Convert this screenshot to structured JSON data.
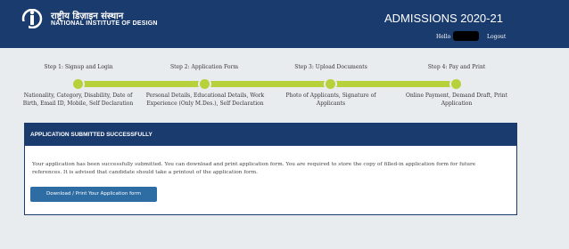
{
  "header": {
    "brand_hindi": "राष्ट्रीय डिज़ाइन संस्थान",
    "brand_english": "NATIONAL INSTITUTE OF DESIGN",
    "title": "ADMISSIONS 2020-21",
    "hello_label": "Hello",
    "logout_label": "Logout",
    "bg_color": "#1a3b6d"
  },
  "steps": [
    {
      "title": "Step 1: Signup and Login",
      "desc": "Nationality, Category, Disability, Date of Birth, Email ID, Mobile, Self Declaration"
    },
    {
      "title": "Step 2: Application Form",
      "desc": "Personal Details, Educational Details, Work Experience (Only M.Des.), Self Declaration"
    },
    {
      "title": "Step 3: Upload Documents",
      "desc": "Photo of Applicants, Signature of Applicants"
    },
    {
      "title": "Step 4: Pay and Print",
      "desc": "Online Payment, Demand Draft, Print Application"
    }
  ],
  "progress": {
    "completed_steps": 4,
    "total_steps": 4,
    "color": "#b6d13a"
  },
  "panel": {
    "heading": "APPLICATION SUBMITTED SUCCESSFULLY",
    "message": "Your application has been successfully submitted. You can download and print application form. You are required to store the copy of filled-in application form for future references. It is advised that candidate should take a printout of the application form.",
    "button_label": "Download / Print Your Application form"
  }
}
